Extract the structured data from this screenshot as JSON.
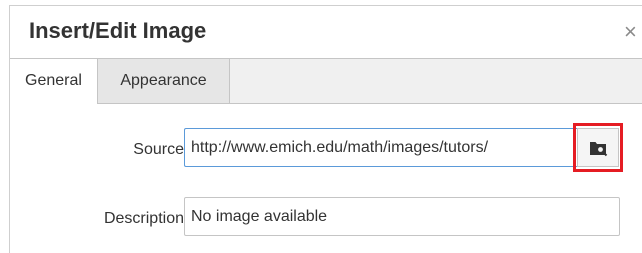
{
  "dialog": {
    "title": "Insert/Edit Image",
    "close_label": "×"
  },
  "tabs": [
    {
      "label": "General",
      "active": true
    },
    {
      "label": "Appearance",
      "active": false
    }
  ],
  "form": {
    "source_label": "Source",
    "source_value": "http://www.emich.edu/math/images/tutors/",
    "browse_icon": "folder-search-icon",
    "description_label": "Description",
    "description_value": "No image available"
  },
  "colors": {
    "highlight": "#e51c23",
    "focus_border": "#5b9ad9"
  }
}
